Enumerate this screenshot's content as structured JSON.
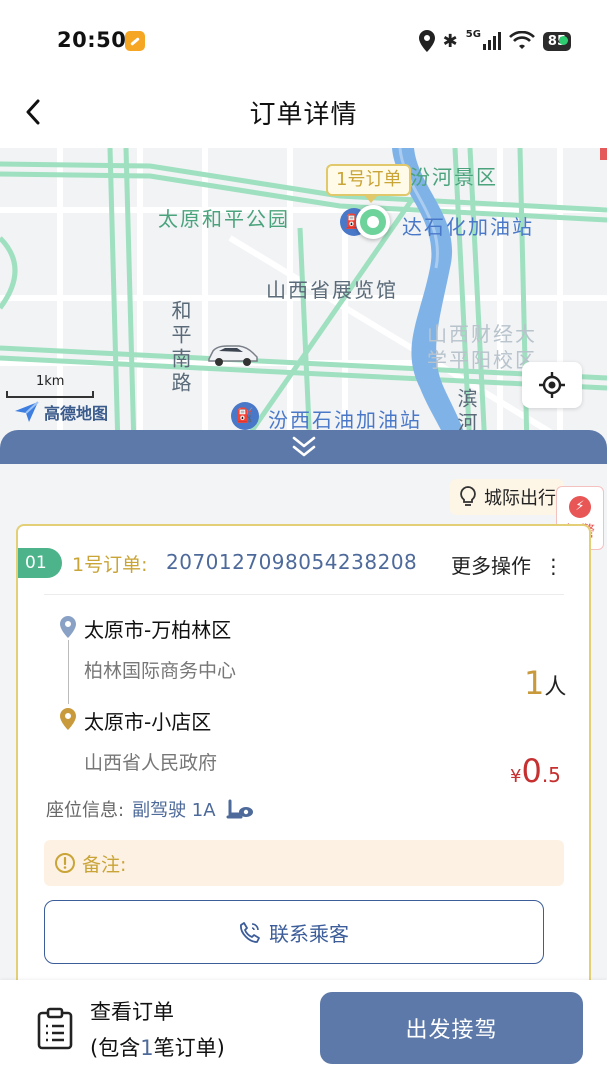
{
  "status_bar": {
    "time": "20:50",
    "network": "5G",
    "battery": "85",
    "icons": [
      "app-notification-icon",
      "location-icon",
      "bluetooth-icon",
      "signal-icon",
      "wifi-icon",
      "battery-icon"
    ]
  },
  "header": {
    "title": "订单详情",
    "back_icon": "chevron-left-icon"
  },
  "map": {
    "order_tag": "1号订单",
    "labels": {
      "park": "太原和平公园",
      "scenic": "汾河景区",
      "gas_station_top": "达石化加油站",
      "exhibition": "山西省展览馆",
      "university_line1": "山西财经大",
      "university_line2": "学平阳校区",
      "road": "和平南路",
      "gas_station_bottom": "汾西石油加油站",
      "river_road": "滨河"
    },
    "scale": "1km",
    "logo": "高德地图"
  },
  "panel": {
    "intercity_label": "城际出行",
    "alarm_label": "报警"
  },
  "order": {
    "index": "01",
    "label": "1号订单:",
    "id": "2070127098054238208",
    "more_ops": "更多操作",
    "more_icon": "more-vertical-icon",
    "from_city": "太原市-万柏林区",
    "from_addr": "柏林国际商务中心",
    "to_city": "太原市-小店区",
    "to_addr": "山西省人民政府",
    "passengers": "1",
    "passenger_unit": "人",
    "currency": "¥",
    "price_int": "0",
    "price_dec": ".5",
    "seat_label": "座位信息:",
    "seat_value": "副驾驶 1A",
    "remark_label": "备注:",
    "contact_label": "联系乘客"
  },
  "bottom": {
    "view_orders": "查看订单",
    "contains_prefix": "(包含",
    "contains_count": "1",
    "contains_suffix": "笔订单)",
    "depart_button": "出发接驾"
  },
  "colors": {
    "primary": "#5d79a9",
    "gold": "#c9a437",
    "card_border": "#e3cf75",
    "price_red": "#c63030",
    "badge_green": "#4cb38a",
    "road_green": "#9ee0bf",
    "river": "#7fb3e8"
  }
}
